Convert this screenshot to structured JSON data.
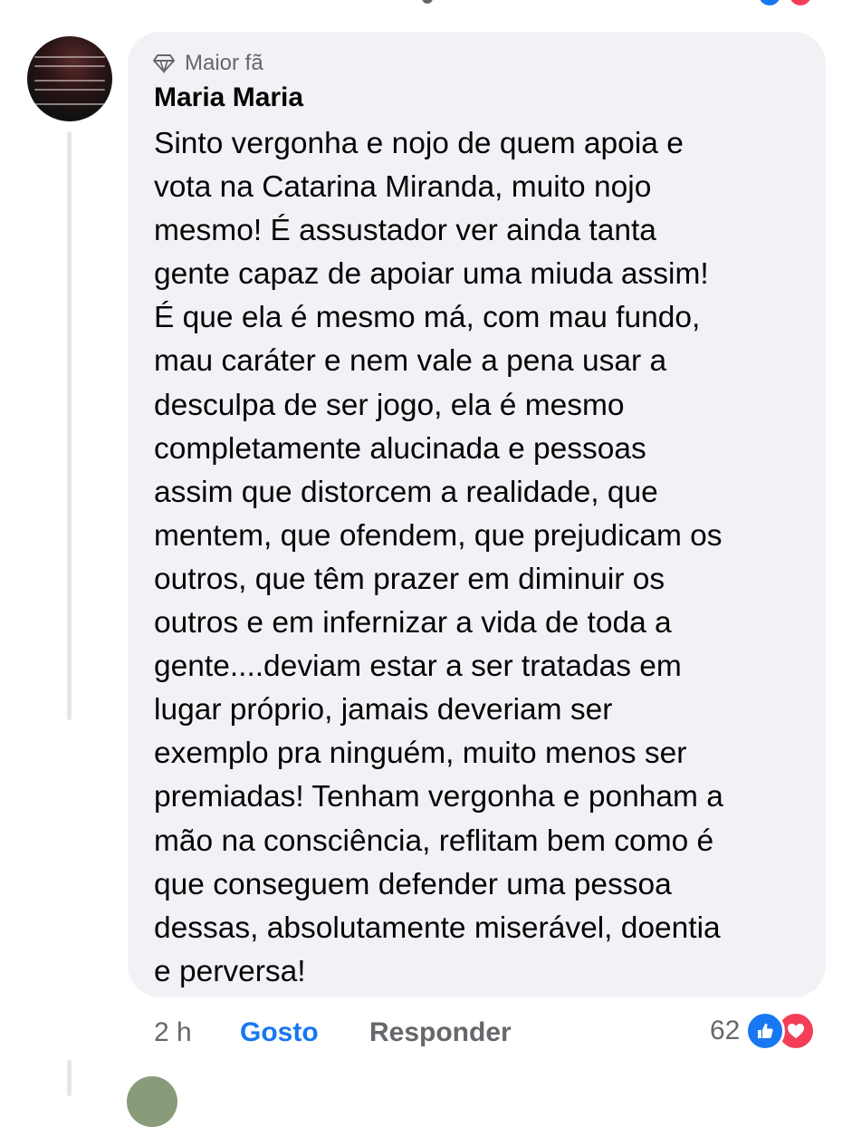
{
  "comment": {
    "badge": "Maior fã",
    "author": "Maria Maria",
    "text": "Sinto vergonha e nojo de quem apoia e\nvota na Catarina Miranda, muito nojo\nmesmo! É assustador ver ainda tanta\ngente capaz de apoiar uma miuda assim!\nÉ que ela é mesmo má, com mau fundo,\nmau caráter e nem vale a pena usar a\ndesculpa de ser jogo, ela é mesmo\ncompletamente alucinada e pessoas\nassim que distorcem a realidade, que\nmentem, que ofendem, que prejudicam os\noutros, que têm prazer em diminuir os\noutros e em infernizar a vida de toda a\ngente....deviam estar a ser tratadas em\nlugar próprio, jamais deveriam ser\nexemplo pra ninguém, muito menos ser\npremiadas! Tenham vergonha e ponham a\nmão na consciência, reflitam bem como é\nque conseguem defender uma pessoa\ndessas, absolutamente miserável, doentia\ne perversa!",
    "badge_icon": "diamond-icon"
  },
  "actions": {
    "time": "2 h",
    "like_label": "Gosto",
    "reply_label": "Responder",
    "reaction_count": "62",
    "reaction_icons": [
      "like-icon",
      "love-icon"
    ]
  },
  "colors": {
    "bubble": "#f0f2f5",
    "link_active": "#1877f2",
    "secondary_text": "#65676b",
    "love": "#f33e58"
  }
}
